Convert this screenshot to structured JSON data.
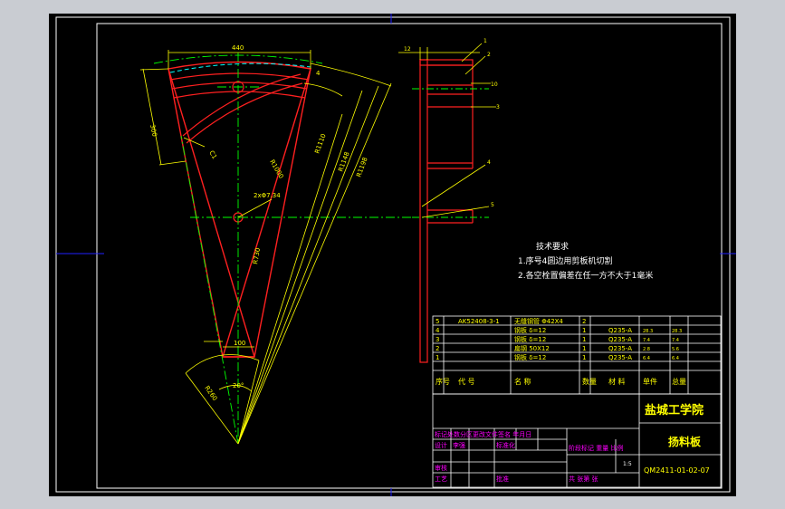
{
  "colors": {
    "viewport_bg": "#c9ccd2",
    "paper": "#000000",
    "frame": "#ffffff",
    "part": "#ff2020",
    "dim": "#ffff00",
    "center": "#00ff00",
    "hidden": "#00ffff",
    "table_text": "#ffff00",
    "magenta": "#ff00ff",
    "blue": "#2020ff"
  },
  "dims": {
    "top_width": "440",
    "side_300": "300",
    "leader_4": "4",
    "radius_small": "R1000",
    "radius_big_a": "R1110",
    "radius_big_b": "R1148",
    "radius_big_c": "R1198",
    "hole": "2xΦ7.34",
    "r_mid": "R730",
    "bottom_100": "100",
    "r_bottom": "R260",
    "angle": "20°",
    "small_c": "C1"
  },
  "section": {
    "label_12": "12",
    "balloon_1": "1",
    "balloon_2": "2",
    "balloon_3": "3",
    "balloon_4": "4",
    "balloon_5": "5",
    "dim_10": "10"
  },
  "notes": {
    "title": "技术要求",
    "line1": "1.序号4圆边用剪板机切割",
    "line2": "2.各空栓置偏差在任一方不大于1毫米"
  },
  "bom": {
    "rows": [
      {
        "no": "5",
        "code": "AK52408-3-1",
        "name": "无缝钢管 Φ42X4",
        "qty": "2",
        "material": "",
        "unit": "",
        "total": ""
      },
      {
        "no": "4",
        "code": "",
        "name": "钢板 δ=12",
        "qty": "1",
        "material": "Q235-A",
        "unit": "28.3",
        "total": "28.3"
      },
      {
        "no": "3",
        "code": "",
        "name": "钢板 δ=12",
        "qty": "1",
        "material": "Q235-A",
        "unit": "7.4",
        "total": "7.4"
      },
      {
        "no": "2",
        "code": "",
        "name": "扁钢 50X12",
        "qty": "1",
        "material": "Q235-A",
        "unit": "2.8",
        "total": "5.6"
      },
      {
        "no": "1",
        "code": "",
        "name": "钢板 δ=12",
        "qty": "1",
        "material": "Q235-A",
        "unit": "6.4",
        "total": "6.4"
      }
    ],
    "header": {
      "no": "序号",
      "code": "代 号",
      "name": "名 称",
      "qty": "数量",
      "material": "材 料",
      "unit": "单件",
      "total": "总量"
    }
  },
  "title_block": {
    "school": "盐城工学院",
    "part_name": "扬料板",
    "drawing_no": "QM2411-01-02-07",
    "rev_header": "标记处数分区更改文件签名 年月日",
    "design": "设计",
    "design_name": "李强",
    "std": "标准化",
    "review": "审核",
    "process": "工艺",
    "approve": "批准",
    "stage_marks": "阶段标记 重量 比例",
    "scale": "1:5",
    "sheets": "共 张第 张"
  }
}
